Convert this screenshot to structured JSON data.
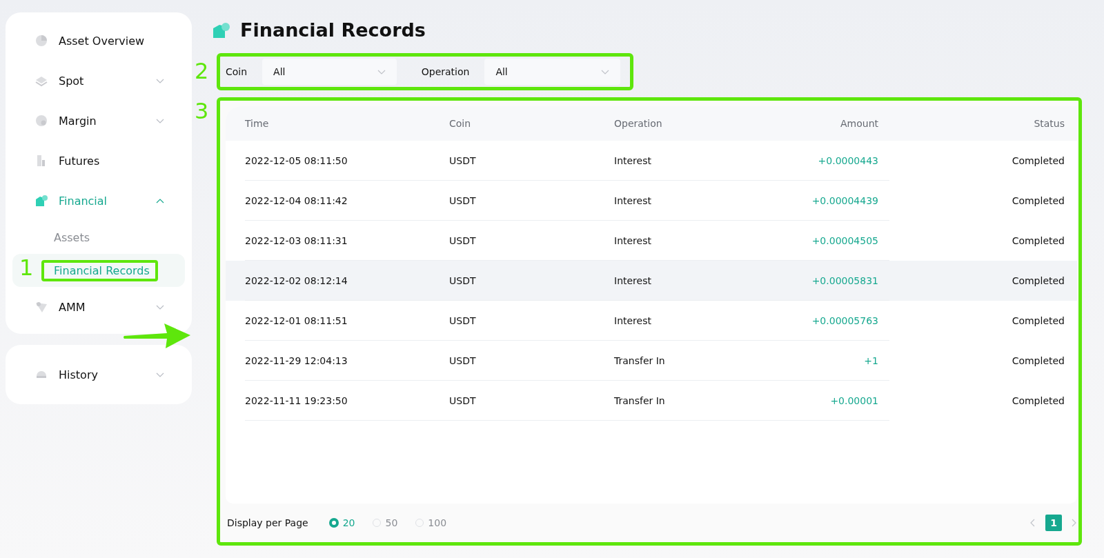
{
  "sidebar": {
    "items": [
      {
        "label": "Asset Overview",
        "kind": "pie",
        "expandable": false,
        "selected": false
      },
      {
        "label": "Spot",
        "kind": "layers",
        "expandable": true,
        "expanded": false,
        "selected": false
      },
      {
        "label": "Margin",
        "kind": "circle",
        "expandable": true,
        "expanded": false,
        "selected": false
      },
      {
        "label": "Futures",
        "kind": "bars",
        "expandable": false,
        "selected": false
      },
      {
        "label": "Financial",
        "kind": "house",
        "expandable": true,
        "expanded": true,
        "selected": true,
        "children": [
          {
            "label": "Assets",
            "selected": false
          },
          {
            "label": "Financial Records",
            "selected": true,
            "annotation": "1"
          }
        ]
      },
      {
        "label": "AMM",
        "kind": "triangle",
        "expandable": true,
        "expanded": false,
        "selected": false
      }
    ]
  },
  "history": {
    "label": "History",
    "kind": "dome",
    "expandable": true,
    "expanded": false,
    "selected": false
  },
  "page_title": "Financial Records",
  "filters": {
    "annotation": "2",
    "fields": [
      {
        "label": "Coin",
        "value": "All"
      },
      {
        "label": "Operation",
        "value": "All"
      }
    ]
  },
  "table": {
    "annotation": "3",
    "columns": [
      "Time",
      "Coin",
      "Operation",
      "Amount",
      "Status"
    ],
    "rows": [
      {
        "cells": [
          "2022-12-05 08:11:50",
          "USDT",
          "Interest",
          "+0.0000443",
          "Completed"
        ],
        "highlighted": false
      },
      {
        "cells": [
          "2022-12-04 08:11:42",
          "USDT",
          "Interest",
          "+0.00004439",
          "Completed"
        ],
        "highlighted": false
      },
      {
        "cells": [
          "2022-12-03 08:11:31",
          "USDT",
          "Interest",
          "+0.00004505",
          "Completed"
        ],
        "highlighted": false
      },
      {
        "cells": [
          "2022-12-02 08:12:14",
          "USDT",
          "Interest",
          "+0.00005831",
          "Completed"
        ],
        "highlighted": true
      },
      {
        "cells": [
          "2022-12-01 08:11:51",
          "USDT",
          "Interest",
          "+0.00005763",
          "Completed"
        ],
        "highlighted": false
      },
      {
        "cells": [
          "2022-11-29 12:04:13",
          "USDT",
          "Transfer In",
          "+1",
          "Completed"
        ],
        "highlighted": false
      },
      {
        "cells": [
          "2022-11-11 19:23:50",
          "USDT",
          "Transfer In",
          "+0.00001",
          "Completed"
        ],
        "highlighted": false
      }
    ]
  },
  "pagination": {
    "label": "Display per Page",
    "options": [
      {
        "label": "20",
        "selected": true
      },
      {
        "label": "50",
        "selected": false
      },
      {
        "label": "100",
        "selected": false
      }
    ],
    "pages": [
      {
        "label": "1",
        "selected": true
      }
    ]
  },
  "annotation_arrow": true
}
